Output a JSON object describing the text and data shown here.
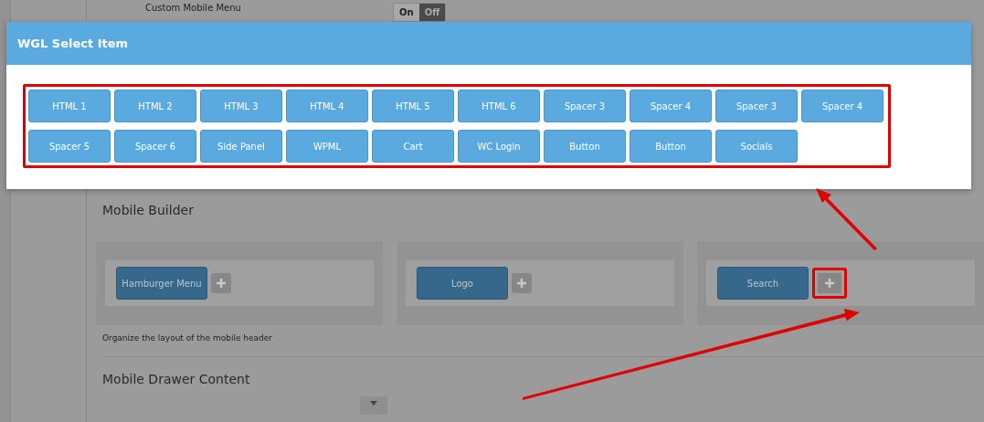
{
  "setting": {
    "label": "Custom Mobile Menu",
    "toggle": [
      {
        "label": "On",
        "selected": false
      },
      {
        "label": "Off",
        "selected": true
      }
    ]
  },
  "mobile_builder": {
    "title": "Mobile Builder",
    "columns": [
      {
        "items": [
          "Hamburger Menu"
        ],
        "highlighted": false
      },
      {
        "items": [
          "Logo"
        ],
        "highlighted": false
      },
      {
        "items": [
          "Search"
        ],
        "highlighted": true
      }
    ],
    "hint": "Organize the layout of the mobile header"
  },
  "drawer": {
    "title": "Mobile Drawer Content"
  },
  "modal": {
    "title": "WGL Select Item",
    "items": [
      "HTML 1",
      "HTML 2",
      "HTML 3",
      "HTML 4",
      "HTML 5",
      "HTML 6",
      "Spacer 3",
      "Spacer 4",
      "Spacer 3",
      "Spacer 4",
      "Spacer 5",
      "Spacer 6",
      "Side Panel",
      "WPML",
      "Cart",
      "WC Login",
      "Button",
      "Button",
      "Socials"
    ]
  }
}
